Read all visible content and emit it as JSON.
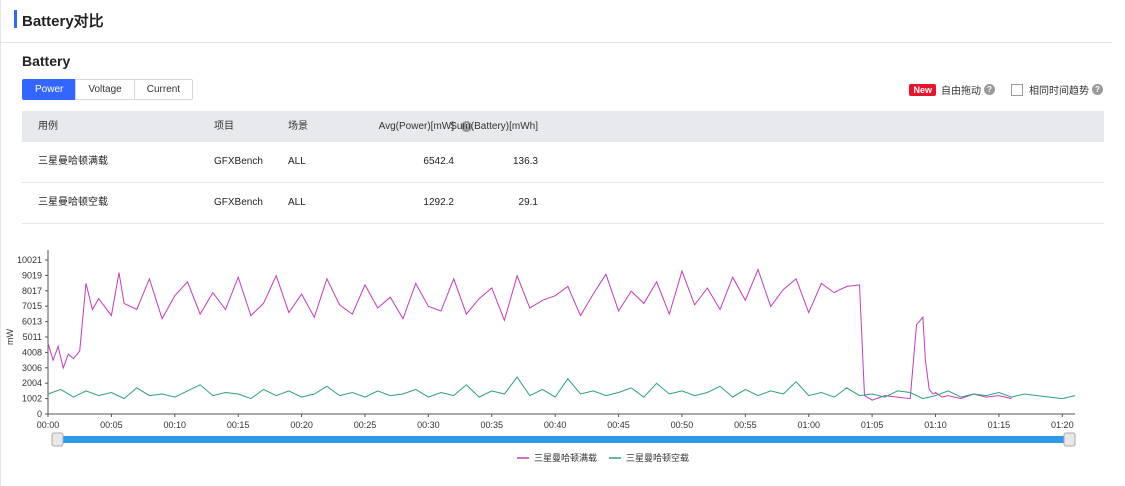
{
  "header": {
    "title": "Battery对比"
  },
  "section": {
    "title": "Battery"
  },
  "tabs": [
    {
      "label": "Power",
      "active": true
    },
    {
      "label": "Voltage",
      "active": false
    },
    {
      "label": "Current",
      "active": false
    }
  ],
  "options": {
    "new_badge": "New",
    "drag_label": "自由拖动",
    "same_time_label": "相同时间趋势",
    "help_glyph": "?"
  },
  "table": {
    "columns": [
      "用例",
      "项目",
      "场景",
      "Avg(Power)[mW]",
      "Sum(Battery)[mWh]"
    ],
    "rows": [
      [
        "三星曼哈顿满载",
        "GFXBench",
        "ALL",
        "6542.4",
        "136.3"
      ],
      [
        "三星曼哈顿空载",
        "GFXBench",
        "ALL",
        "1292.2",
        "29.1"
      ]
    ]
  },
  "colors": {
    "accent": "#3366ff",
    "series_full": "#c43cb8",
    "series_idle": "#2aa27a",
    "new_badge": "#e8142e"
  },
  "chart_data": {
    "type": "line",
    "ylabel": "mW",
    "xlabel": "",
    "ylim": [
      0,
      10021
    ],
    "y_ticks": [
      0,
      1002,
      2004,
      3006,
      4008,
      5011,
      6013,
      7015,
      8017,
      9019,
      10021
    ],
    "x_range_seconds": [
      0,
      81
    ],
    "x_ticks": [
      "00:00",
      "00:05",
      "00:10",
      "00:15",
      "00:20",
      "00:25",
      "00:30",
      "00:35",
      "00:40",
      "00:45",
      "00:50",
      "00:55",
      "01:00",
      "01:05",
      "01:10",
      "01:15",
      "01:20"
    ],
    "legend_position": "bottom-center",
    "series": [
      {
        "name": "三星曼哈顿满载",
        "x": [
          0,
          0.4,
          0.8,
          1.2,
          1.6,
          2,
          2.5,
          3,
          3.5,
          4,
          5,
          5.6,
          6,
          7,
          8,
          9,
          10,
          11,
          12,
          13,
          14,
          15,
          16,
          17,
          18,
          19,
          20,
          21,
          22,
          23,
          24,
          25,
          26,
          27,
          28,
          29,
          30,
          31,
          32,
          33,
          34,
          35,
          36,
          37,
          38,
          39,
          40,
          41,
          42,
          43,
          44,
          45,
          46,
          47,
          48,
          49,
          50,
          51,
          52,
          53,
          54,
          55,
          56,
          57,
          58,
          59,
          60,
          61,
          62,
          63,
          64,
          64.4,
          64.8,
          65,
          66,
          67,
          68,
          68.5,
          69,
          69.2,
          69.5,
          69.8,
          70,
          70.5,
          71,
          72,
          73,
          74,
          75,
          76
        ],
        "y": [
          4600,
          3500,
          4400,
          3000,
          3900,
          3600,
          4100,
          8500,
          6800,
          7500,
          6400,
          9200,
          7200,
          6800,
          8800,
          6200,
          7700,
          8600,
          6500,
          7900,
          6800,
          8900,
          6400,
          7200,
          9000,
          6600,
          7800,
          6300,
          8800,
          7100,
          6500,
          8400,
          6900,
          7600,
          6200,
          8500,
          7000,
          6700,
          8800,
          6500,
          7500,
          8200,
          6100,
          9000,
          6900,
          7400,
          7700,
          8300,
          6400,
          7800,
          9100,
          6700,
          8000,
          7200,
          8600,
          6500,
          9300,
          7100,
          8200,
          6800,
          8900,
          7400,
          9400,
          7000,
          8100,
          8800,
          6600,
          8500,
          7900,
          8300,
          8400,
          1200,
          1000,
          900,
          1200,
          1100,
          1000,
          5800,
          6300,
          3500,
          1600,
          1300,
          1400,
          1100,
          1200,
          1000,
          1300,
          1100,
          1200,
          1000
        ]
      },
      {
        "name": "三星曼哈顿空载",
        "x": [
          0,
          1,
          2,
          3,
          4,
          5,
          6,
          7,
          8,
          9,
          10,
          11,
          12,
          13,
          14,
          15,
          16,
          17,
          18,
          19,
          20,
          21,
          22,
          23,
          24,
          25,
          26,
          27,
          28,
          29,
          30,
          31,
          32,
          33,
          34,
          35,
          36,
          37,
          38,
          39,
          40,
          41,
          42,
          43,
          44,
          45,
          46,
          47,
          48,
          49,
          50,
          51,
          52,
          53,
          54,
          55,
          56,
          57,
          58,
          59,
          60,
          61,
          62,
          63,
          64,
          65,
          66,
          67,
          68,
          69,
          70,
          71,
          72,
          73,
          74,
          75,
          76,
          77,
          78,
          79,
          80,
          81
        ],
        "y": [
          1300,
          1600,
          1100,
          1500,
          1200,
          1400,
          1000,
          1700,
          1200,
          1300,
          1100,
          1500,
          1900,
          1200,
          1400,
          1300,
          1000,
          1600,
          1200,
          1500,
          1100,
          1300,
          1800,
          1200,
          1400,
          1100,
          1500,
          1200,
          1300,
          1600,
          1100,
          1400,
          1200,
          1900,
          1100,
          1500,
          1300,
          2400,
          1200,
          1600,
          1100,
          2300,
          1300,
          1500,
          1200,
          1400,
          1700,
          1100,
          2000,
          1300,
          1500,
          1200,
          1400,
          1800,
          1100,
          1600,
          1200,
          1500,
          1300,
          2100,
          1200,
          1400,
          1100,
          1700,
          1200,
          1300,
          1100,
          1500,
          1400,
          1000,
          1200,
          1500,
          1100,
          1300,
          1200,
          1400,
          1100,
          1300,
          1200,
          1100,
          1000,
          1200
        ]
      }
    ]
  }
}
